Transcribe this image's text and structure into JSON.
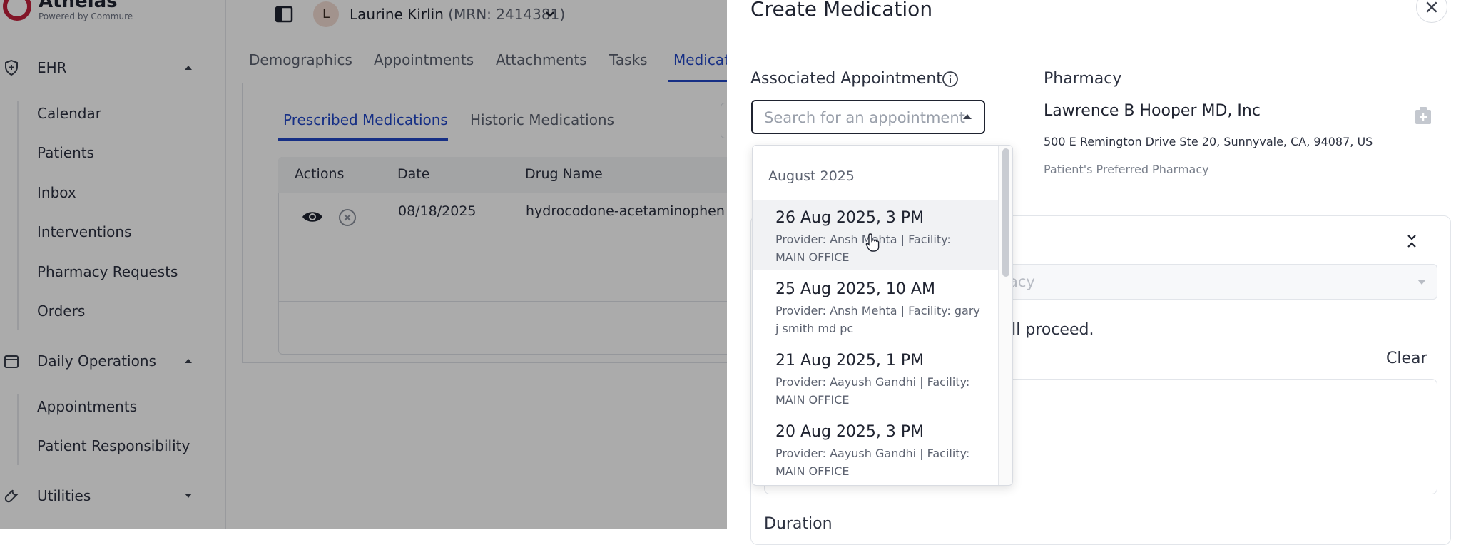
{
  "brand": {
    "name": "Athelas",
    "tagline": "Powered by Commure",
    "accent": "#c2203b"
  },
  "sidebar": {
    "groups": [
      {
        "label": "EHR",
        "icon": "shield-icon",
        "expanded": true,
        "items": [
          "Calendar",
          "Patients",
          "Inbox",
          "Interventions",
          "Pharmacy Requests",
          "Orders"
        ]
      },
      {
        "label": "Daily Operations",
        "icon": "calendar-icon",
        "expanded": true,
        "items": [
          "Appointments",
          "Patient Responsibility"
        ]
      },
      {
        "label": "Utilities",
        "icon": "wrench-icon",
        "expanded": false,
        "items": []
      }
    ]
  },
  "patient": {
    "avatar_initial": "L",
    "name": "Laurine Kirlin",
    "mrn_text": "(MRN: 2414381)"
  },
  "tabs": [
    "Demographics",
    "Appointments",
    "Attachments",
    "Tasks",
    "Medicat"
  ],
  "active_tab_index": 4,
  "subtabs": [
    "Prescribed Medications",
    "Historic Medications"
  ],
  "table": {
    "headers": [
      "Actions",
      "Date",
      "Drug Name"
    ],
    "rows": [
      {
        "date": "08/18/2025",
        "drug": "hydrocodone-acetaminophen"
      }
    ]
  },
  "modal": {
    "title": "Create Medication",
    "associated_appointment_label": "Associated Appointment",
    "appointment_placeholder": "Search for an appointment",
    "pharmacy_label": "Pharmacy",
    "pharmacy_name": "Lawrence B Hooper MD, Inc",
    "pharmacy_address": "500 E Remington Drive Ste 20, Sunnyvale, CA, 94087, US",
    "pharmacy_note": "Patient's Preferred Pharmacy",
    "disabled_select_placeholder": "acy",
    "proceed_text": "vill proceed.",
    "clear_label": "Clear",
    "duration_label": "Duration"
  },
  "dropdown": {
    "group_label": "August 2025",
    "items": [
      {
        "title": "26 Aug 2025, 3 PM",
        "subtitle": "Provider: Ansh Mehta | Facility: MAIN OFFICE",
        "hovered": true
      },
      {
        "title": "25 Aug 2025, 10 AM",
        "subtitle": "Provider: Ansh Mehta | Facility: gary j smith md pc",
        "hovered": false
      },
      {
        "title": "21 Aug 2025, 1 PM",
        "subtitle": "Provider: Aayush Gandhi | Facility: MAIN OFFICE",
        "hovered": false
      },
      {
        "title": "20 Aug 2025, 3 PM",
        "subtitle": "Provider: Aayush Gandhi | Facility: MAIN OFFICE",
        "hovered": false
      }
    ]
  },
  "colors": {
    "active_blue": "#2146c7",
    "text": "#1f2330",
    "muted": "#5c6270"
  }
}
